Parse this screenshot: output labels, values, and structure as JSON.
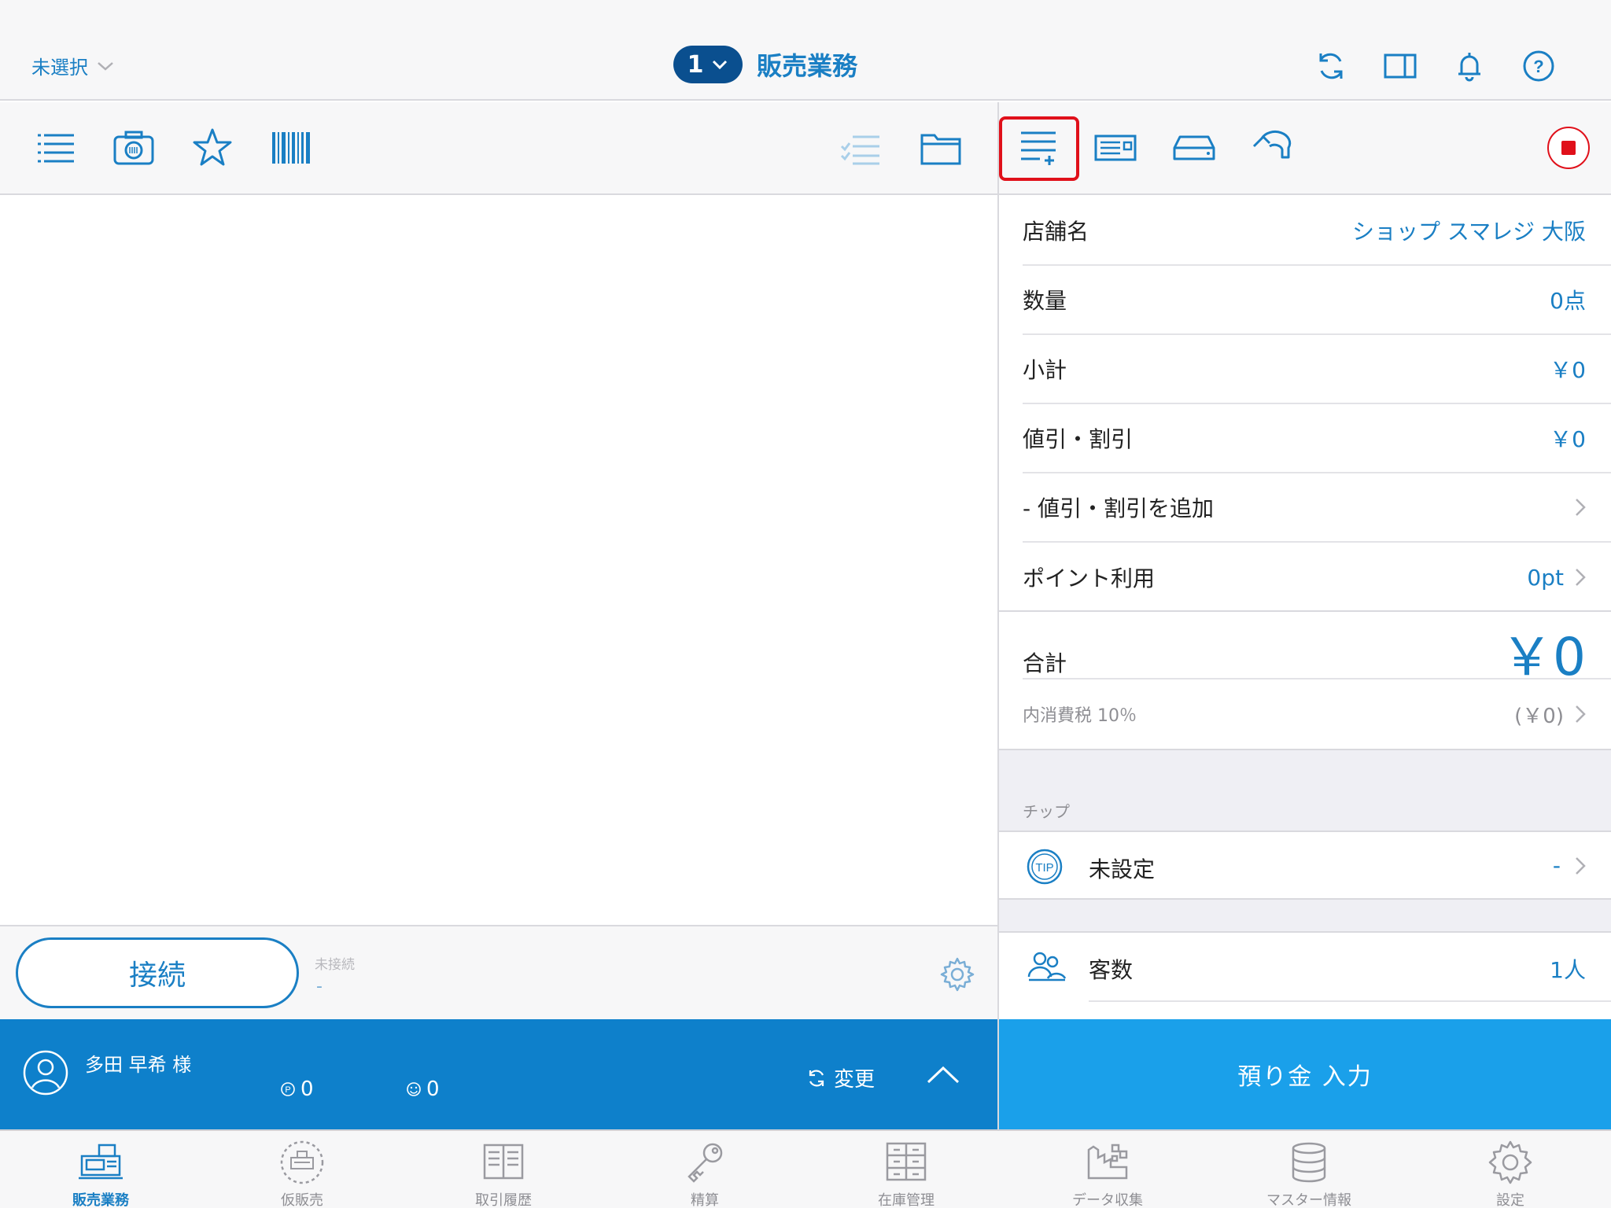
{
  "header": {
    "staff_selector": "未選択",
    "register_number": "1",
    "title": "販売業務"
  },
  "connection": {
    "button_label": "接続",
    "status_label": "未接続",
    "status_value": "-"
  },
  "customer": {
    "name": "多田 早希 様",
    "points": "0",
    "stamps": "0",
    "change_label": "変更"
  },
  "summary": {
    "rows": [
      {
        "label": "店舗名",
        "value": "ショップ スマレジ 大阪"
      },
      {
        "label": "数量",
        "value": "0点"
      },
      {
        "label": "小計",
        "value": "￥0"
      },
      {
        "label": "値引・割引",
        "value": "￥0"
      },
      {
        "label": "- 値引・割引を追加",
        "value": ""
      },
      {
        "label": "ポイント利用",
        "value": "0pt"
      }
    ],
    "total_label": "合計",
    "total_value": "￥0",
    "tax_label": "内消費税 10％",
    "tax_value": "(￥0)"
  },
  "tip": {
    "section_label": "チップ",
    "icon_text": "TIP",
    "label": "未設定",
    "value": "-"
  },
  "customers": {
    "label": "客数",
    "value": "1人"
  },
  "deposit_button": "預り金 入力",
  "tabs": [
    {
      "label": "販売業務",
      "icon": "register-icon",
      "active": true
    },
    {
      "label": "仮販売",
      "icon": "temp-sale-icon",
      "active": false
    },
    {
      "label": "取引履歴",
      "icon": "history-icon",
      "active": false
    },
    {
      "label": "精算",
      "icon": "key-icon",
      "active": false
    },
    {
      "label": "在庫管理",
      "icon": "inventory-icon",
      "active": false
    },
    {
      "label": "データ収集",
      "icon": "data-collect-icon",
      "active": false
    },
    {
      "label": "マスター情報",
      "icon": "database-icon",
      "active": false
    },
    {
      "label": "設定",
      "icon": "gear-icon",
      "active": false
    }
  ],
  "colors": {
    "accent": "#1a7fc4",
    "customer_bar": "#0e80cb",
    "deposit": "#1aa0ea",
    "highlight": "#e0101a"
  }
}
